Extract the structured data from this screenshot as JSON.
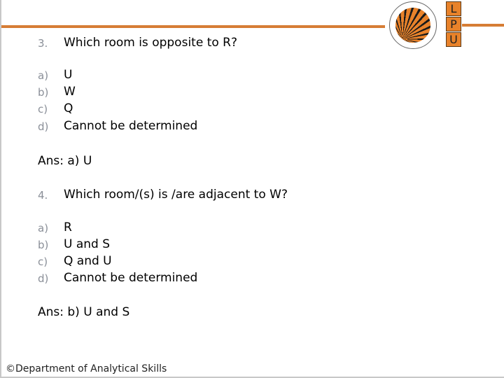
{
  "header": {
    "logo_name": "Lovely Professional University",
    "logo_letters": [
      "L",
      "P",
      "U"
    ],
    "accent_color": "#d67d35"
  },
  "questions": [
    {
      "number": "3.",
      "question": "Which room is opposite to R?",
      "options": [
        {
          "label": "a)",
          "text": "U"
        },
        {
          "label": "b)",
          "text": "W"
        },
        {
          "label": "c)",
          "text": "Q"
        },
        {
          "label": "d)",
          "text": "Cannot be determined"
        }
      ],
      "answer": "Ans: a) U"
    },
    {
      "number": "4.",
      "question": "Which room/(s) is /are adjacent to W?",
      "options": [
        {
          "label": "a)",
          "text": "R"
        },
        {
          "label": "b)",
          "text": "U and S"
        },
        {
          "label": "c)",
          "text": "Q and U"
        },
        {
          "label": "d)",
          "text": "Cannot be determined"
        }
      ],
      "answer": "Ans: b) U and S"
    }
  ],
  "footer": {
    "text": "©Department of Analytical Skills"
  }
}
